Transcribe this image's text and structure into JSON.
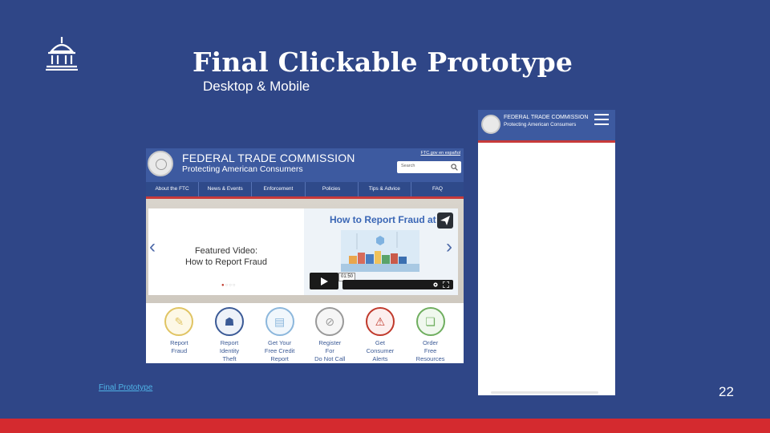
{
  "slide": {
    "title": "Final Clickable Prototype",
    "subtitle": "Desktop & Mobile",
    "link_text": "Final Prototype",
    "page_number": "22"
  },
  "desktop": {
    "agency_name": "FEDERAL TRADE COMMISSION",
    "tagline": "Protecting American Consumers",
    "espanol_link": "FTC.gov en español",
    "search_placeholder": "Search",
    "nav": [
      "About the FTC",
      "News & Events",
      "Enforcement",
      "Policies",
      "Tips & Advice",
      "FAQ"
    ],
    "featured": "Featured Video:\nHow to Report Fraud",
    "video_title": "How to Report Fraud at",
    "video_time": "01:50",
    "quick_links": [
      {
        "label": "Report\nFraud",
        "icon": "document-pen-icon",
        "color": "#e0c463"
      },
      {
        "label": "Report\nIdentity\nTheft",
        "icon": "hacker-laptop-icon",
        "color": "#3b5a96"
      },
      {
        "label": "Get Your\nFree Credit\nReport",
        "icon": "credit-report-icon",
        "color": "#8cb7dc"
      },
      {
        "label": "Register\nFor\nDo Not Call",
        "icon": "no-call-phone-icon",
        "color": "#999999"
      },
      {
        "label": "Get\nConsumer\nAlerts",
        "icon": "warning-icon",
        "color": "#c0392b"
      },
      {
        "label": "Order\nFree\nResources",
        "icon": "order-resources-icon",
        "color": "#6fae5f"
      }
    ]
  },
  "mobile": {
    "agency_name": "FEDERAL TRADE COMMISSION",
    "tagline": "Protecting American Consumers"
  }
}
